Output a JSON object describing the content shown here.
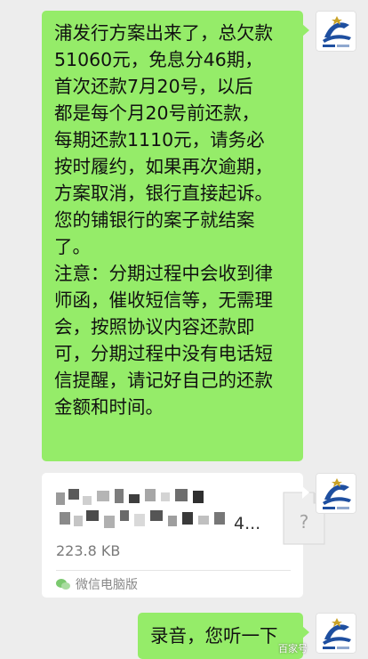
{
  "messages": [
    {
      "type": "text",
      "lines": [
        "浦发行方案出来了，总欠款",
        "51060元，免息分46期，",
        "首次还款7月20号，以后",
        "都是每个月20号前还款，",
        "每期还款1110元，请务必",
        "按时履约，如果再次逾期，",
        "方案取消，银行直接起诉。",
        "您的铺银行的案子就结案",
        "了。",
        "注意：分期过程中会收到律",
        "师函，催收短信等，无需理",
        "会，按照协议内容还款即",
        "可，分期过程中没有电话短",
        "信提醒，请记好自己的还款",
        "金额和时间。"
      ]
    },
    {
      "type": "file",
      "name_suffix": "4...",
      "size": "223.8 KB",
      "source": "微信电脑版"
    },
    {
      "type": "text",
      "lines": [
        "录音，您听一下"
      ]
    }
  ],
  "watermark": "百家号",
  "colors": {
    "background": "#ededed",
    "sent_bubble": "#95ec69",
    "file_card": "#ffffff"
  }
}
